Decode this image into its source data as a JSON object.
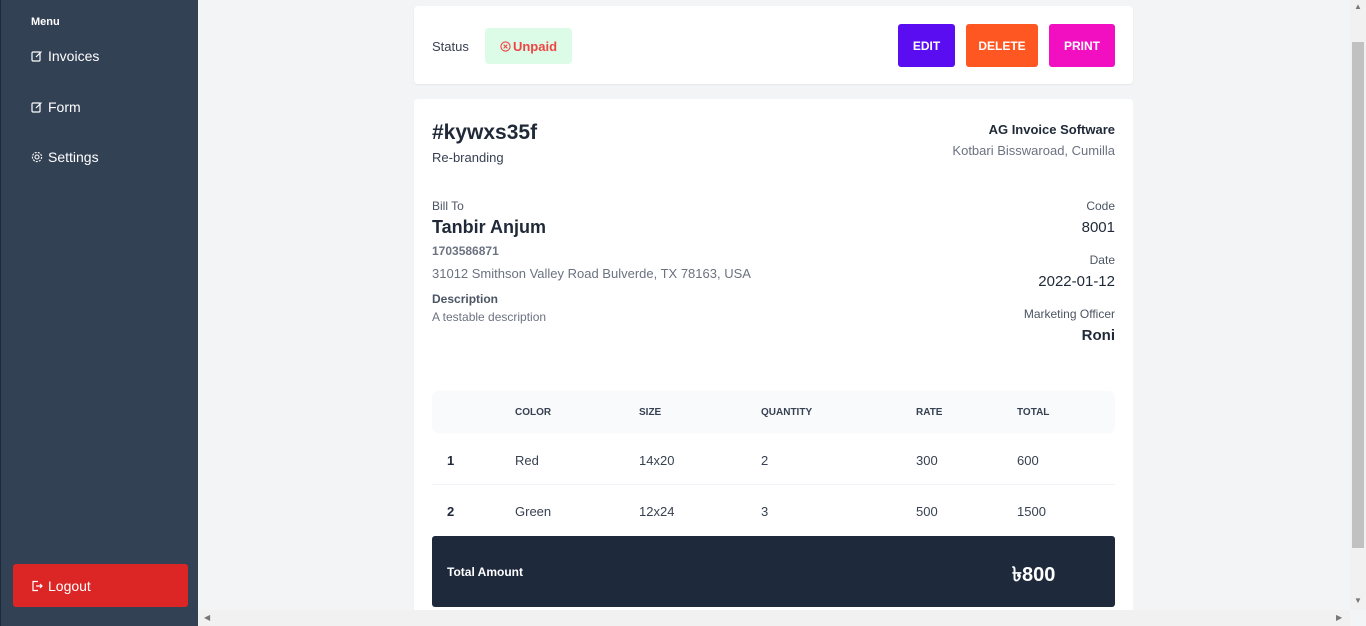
{
  "sidebar": {
    "menu_title": "Menu",
    "items": [
      {
        "label": "Invoices",
        "icon": "edit-icon"
      },
      {
        "label": "Form",
        "icon": "edit-icon"
      },
      {
        "label": "Settings",
        "icon": "gear-icon"
      }
    ],
    "logout_label": "Logout"
  },
  "status": {
    "label": "Status",
    "badge": "Unpaid"
  },
  "actions": {
    "edit": "EDIT",
    "delete": "DELETE",
    "print": "PRINT"
  },
  "invoice": {
    "id": "#kywxs35f",
    "subtitle": "Re-branding",
    "company": "AG Invoice Software",
    "company_address": "Kotbari Bisswaroad, Cumilla",
    "bill_to_label": "Bill To",
    "client_name": "Tanbir Anjum",
    "client_phone": "1703586871",
    "client_address": "31012 Smithson Valley Road Bulverde, TX 78163, USA",
    "description_label": "Description",
    "description": "A testable description",
    "code_label": "Code",
    "code": "8001",
    "date_label": "Date",
    "date": "2022-01-12",
    "officer_label": "Marketing Officer",
    "officer": "Roni"
  },
  "table": {
    "headers": [
      "COLOR",
      "SIZE",
      "QUANTITY",
      "RATE",
      "TOTAL"
    ],
    "rows": [
      [
        "1",
        "Red",
        "14x20",
        "2",
        "300",
        "600"
      ],
      [
        "2",
        "Green",
        "12x24",
        "3",
        "500",
        "1500"
      ]
    ]
  },
  "total": {
    "label": "Total Amount",
    "value": "৳800"
  },
  "colors": {
    "sidebar": "#334155",
    "edit": "#5b0df2",
    "delete": "#ff5722",
    "print": "#f20fc2",
    "logout": "#dc2626",
    "total_bar": "#1e293b"
  }
}
